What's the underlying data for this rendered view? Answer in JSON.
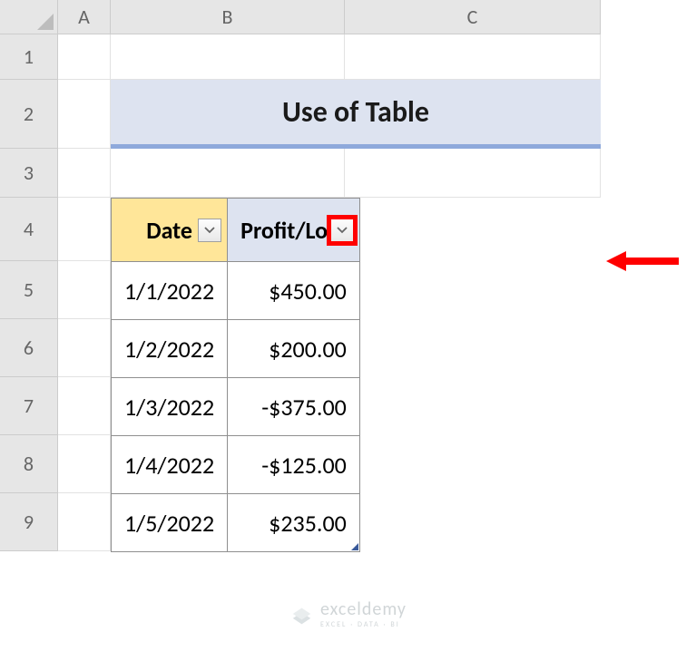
{
  "columns": [
    "A",
    "B",
    "C"
  ],
  "rows": [
    "1",
    "2",
    "3",
    "4",
    "5",
    "6",
    "7",
    "8",
    "9"
  ],
  "title": "Use of Table",
  "table": {
    "headers": {
      "date": "Date",
      "profit_loss": "Profit/Loss"
    },
    "rows": [
      {
        "date": "1/1/2022",
        "value": "$450.00"
      },
      {
        "date": "1/2/2022",
        "value": "$200.00"
      },
      {
        "date": "1/3/2022",
        "value": "-$375.00"
      },
      {
        "date": "1/4/2022",
        "value": "-$125.00"
      },
      {
        "date": "1/5/2022",
        "value": "$235.00"
      }
    ]
  },
  "watermark": {
    "name": "exceldemy",
    "sub": "EXCEL · DATA · BI"
  }
}
